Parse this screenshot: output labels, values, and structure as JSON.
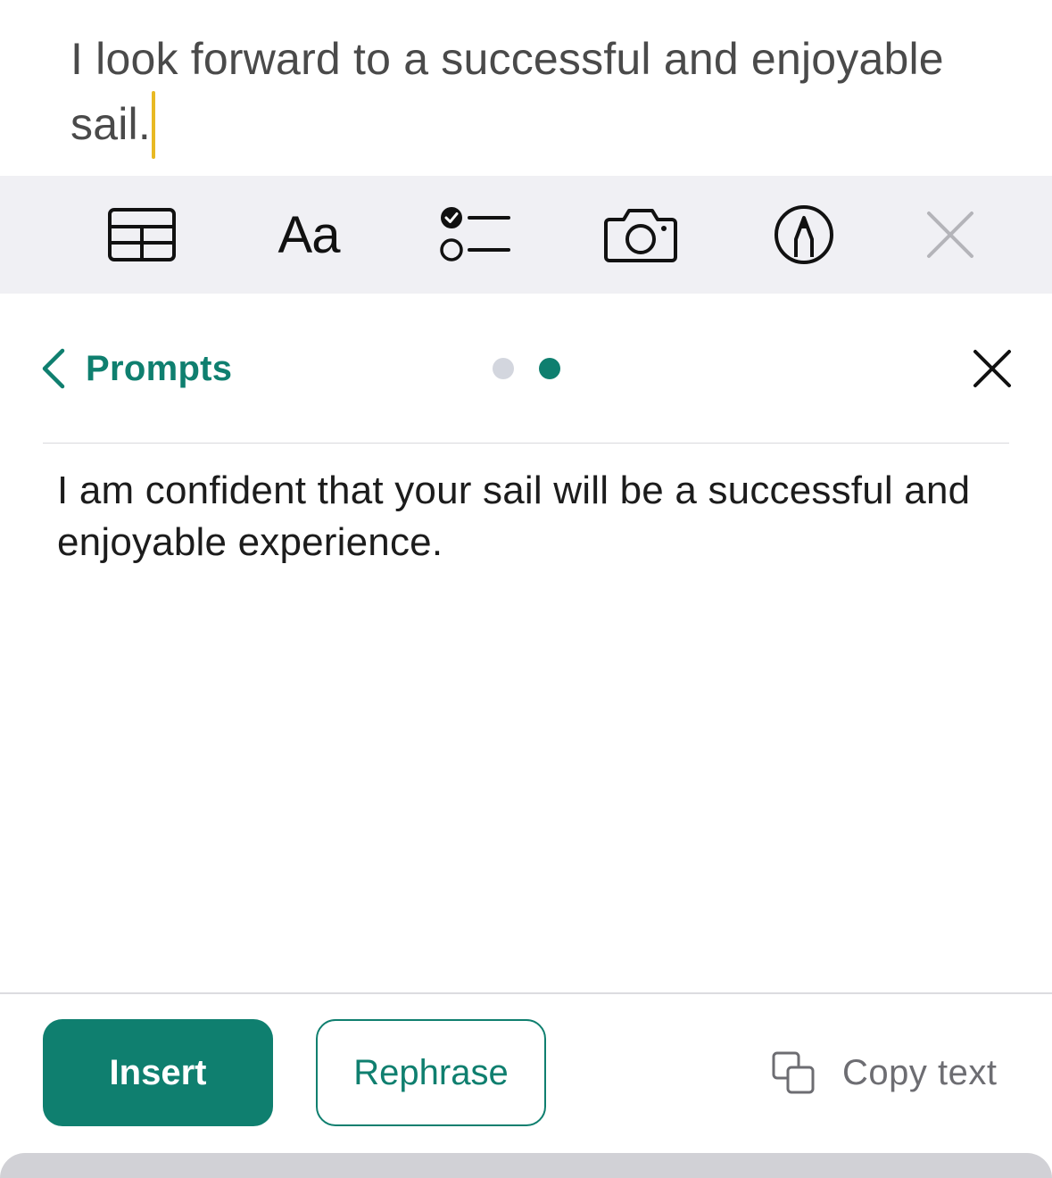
{
  "note": {
    "text": "I look forward to a successful and enjoyable sail."
  },
  "toolbar": {
    "items": [
      {
        "icon": "table-icon"
      },
      {
        "label": "Aa",
        "icon": "text-format-icon"
      },
      {
        "icon": "checklist-icon"
      },
      {
        "icon": "camera-icon"
      },
      {
        "icon": "markup-pen-icon"
      },
      {
        "icon": "close-icon"
      }
    ]
  },
  "panel": {
    "back_label": "Prompts",
    "page_dots": {
      "count": 2,
      "active_index": 1
    },
    "suggestion_text": "I am confident that your sail will be a successful and enjoyable experience."
  },
  "actions": {
    "insert_label": "Insert",
    "rephrase_label": "Rephrase",
    "copy_label": "Copy text"
  },
  "colors": {
    "accent": "#0f7f6f",
    "caret": "#e8b923",
    "toolbar_bg": "#f0f0f4"
  }
}
